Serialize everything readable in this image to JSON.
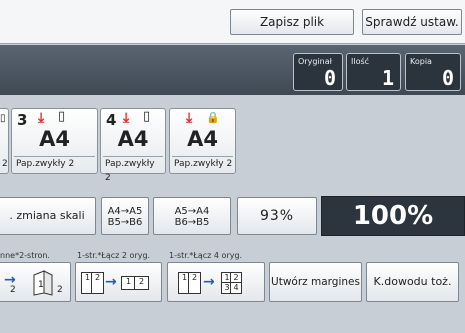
{
  "toolbar": {
    "save_file": "Zapisz plik",
    "check_settings": "Sprawdź ustaw."
  },
  "counters": {
    "original": {
      "label": "Oryginał",
      "value": "0"
    },
    "quantity": {
      "label": "Ilość",
      "value": "1"
    },
    "copy": {
      "label": "Kopia",
      "value": "0"
    }
  },
  "trays": [
    {
      "number": "2",
      "paper_type": "2"
    },
    {
      "number": "3",
      "size": "A4",
      "paper_type": "Pap.zwykły 2"
    },
    {
      "number": "4",
      "size": "A4",
      "paper_type": "Pap.zwykły 2"
    },
    {
      "number": "",
      "size": "A4",
      "paper_type": "Pap.zwykły 2"
    }
  ],
  "zoom": {
    "scale_change": ". zmiana skali",
    "a4_a5_top": "A4→A5",
    "a4_a5_bottom": "B5→B6",
    "a5_a4_top": "A5→A4",
    "a5_a4_bottom": "B6→B5",
    "percent_small": "93%",
    "percent_large": "100%"
  },
  "layout_labels": {
    "duplex": "nne*2-stron.",
    "combine2": "1-str.*Łącz 2 oryg.",
    "combine4": "1-str.*Łącz 4 oryg."
  },
  "bottom": {
    "create_margin": "Utwórz margines",
    "id_card": "K.dowodu toż.",
    "pages": [
      "1",
      "2",
      "1",
      "2",
      "1",
      "2",
      "3",
      "4"
    ],
    "duplex_small": "2"
  }
}
